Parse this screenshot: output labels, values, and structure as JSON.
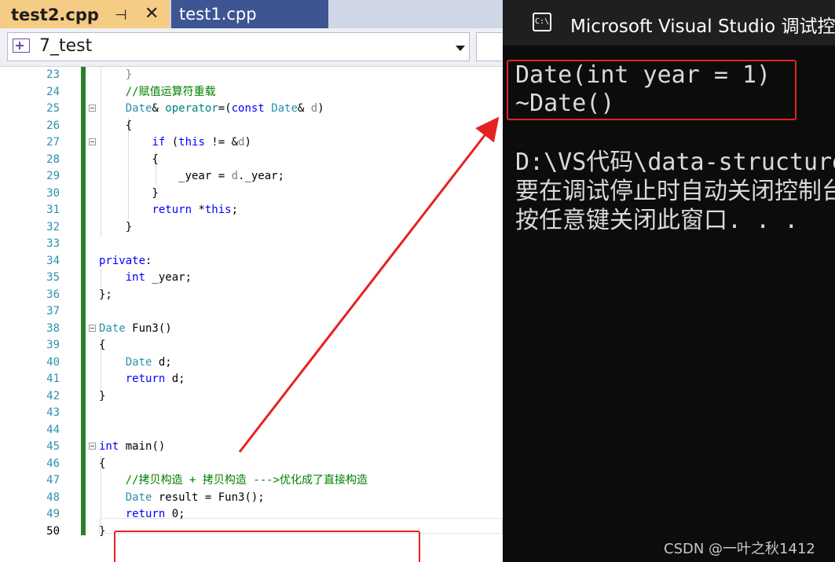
{
  "editor": {
    "tabs": [
      {
        "label": "test2.cpp",
        "active": true
      },
      {
        "label": "test1.cpp",
        "active": false
      }
    ],
    "scope_label": "7_test",
    "lines": [
      {
        "n": "23",
        "tokens": [
          [
            "pm",
            "    }"
          ]
        ]
      },
      {
        "n": "24",
        "tokens": [
          [
            "cm",
            "    //赋值运算符重载"
          ]
        ]
      },
      {
        "n": "25",
        "tokens": [
          [
            "ty",
            "    Date"
          ],
          [
            "",
            "& "
          ],
          [
            "op",
            "operator"
          ],
          [
            "",
            "=("
          ],
          [
            "kw",
            "const"
          ],
          [
            "",
            " "
          ],
          [
            "ty",
            "Date"
          ],
          [
            "",
            "& "
          ],
          [
            "pm",
            "d"
          ],
          [
            "",
            ")"
          ]
        ]
      },
      {
        "n": "26",
        "tokens": [
          [
            "",
            "    {"
          ]
        ]
      },
      {
        "n": "27",
        "tokens": [
          [
            "",
            "        "
          ],
          [
            "kw",
            "if"
          ],
          [
            "",
            " ("
          ],
          [
            "kw",
            "this"
          ],
          [
            "",
            " != &"
          ],
          [
            "pm",
            "d"
          ],
          [
            "",
            ")"
          ]
        ]
      },
      {
        "n": "28",
        "tokens": [
          [
            "",
            "        {"
          ]
        ]
      },
      {
        "n": "29",
        "tokens": [
          [
            "",
            "            _year = "
          ],
          [
            "pm",
            "d"
          ],
          [
            "",
            "._year;"
          ]
        ]
      },
      {
        "n": "30",
        "tokens": [
          [
            "",
            "        }"
          ]
        ]
      },
      {
        "n": "31",
        "tokens": [
          [
            "",
            "        "
          ],
          [
            "kw",
            "return"
          ],
          [
            "",
            " *"
          ],
          [
            "kw",
            "this"
          ],
          [
            "",
            ";"
          ]
        ]
      },
      {
        "n": "32",
        "tokens": [
          [
            "",
            "    }"
          ]
        ]
      },
      {
        "n": "33",
        "tokens": []
      },
      {
        "n": "34",
        "tokens": [
          [
            "kw",
            "private"
          ],
          [
            "",
            ":"
          ]
        ]
      },
      {
        "n": "35",
        "tokens": [
          [
            "",
            "    "
          ],
          [
            "kw",
            "int"
          ],
          [
            "",
            " _year;"
          ]
        ]
      },
      {
        "n": "36",
        "tokens": [
          [
            "",
            "};"
          ]
        ]
      },
      {
        "n": "37",
        "tokens": []
      },
      {
        "n": "38",
        "tokens": [
          [
            "ty",
            "Date"
          ],
          [
            "",
            " Fun3()"
          ]
        ]
      },
      {
        "n": "39",
        "tokens": [
          [
            "",
            "{"
          ]
        ]
      },
      {
        "n": "40",
        "tokens": [
          [
            "ty",
            "    Date"
          ],
          [
            "",
            " d;"
          ]
        ]
      },
      {
        "n": "41",
        "tokens": [
          [
            "kw",
            "    return"
          ],
          [
            "",
            " d;"
          ]
        ]
      },
      {
        "n": "42",
        "tokens": [
          [
            "",
            "}"
          ]
        ]
      },
      {
        "n": "43",
        "tokens": []
      },
      {
        "n": "44",
        "tokens": []
      },
      {
        "n": "45",
        "tokens": [
          [
            "kw",
            "int"
          ],
          [
            "",
            " main()"
          ]
        ]
      },
      {
        "n": "46",
        "tokens": [
          [
            "",
            "{"
          ]
        ]
      },
      {
        "n": "47",
        "tokens": [
          [
            "cm",
            "    //拷贝构造 + 拷贝构造 --->优化成了直接构造"
          ]
        ]
      },
      {
        "n": "48",
        "tokens": [
          [
            "ty",
            "    Date"
          ],
          [
            "",
            " result = Fun3();"
          ]
        ]
      },
      {
        "n": "49",
        "tokens": [
          [
            "kw",
            "    return"
          ],
          [
            "",
            " 0;"
          ]
        ]
      },
      {
        "n": "50",
        "tokens": [
          [
            "",
            "}"
          ]
        ]
      }
    ],
    "fold_lines": [
      "25",
      "27",
      "38",
      "45"
    ],
    "current_line": "50"
  },
  "console": {
    "title": "Microsoft Visual Studio 调试控制台",
    "icon": "console-icon",
    "lines": [
      "Date(int year = 1)",
      "~Date()",
      "",
      "D:\\VS代码\\data-structure",
      "要在调试停止时自动关闭控制台",
      "按任意键关闭此窗口. . ."
    ]
  },
  "watermark": "CSDN @一叶之秋1412",
  "colors": {
    "annotation_red": "#e52222",
    "active_tab": "#f5cc84",
    "inactive_tab": "#3e5593",
    "change_bar": "#2d7d2d"
  }
}
